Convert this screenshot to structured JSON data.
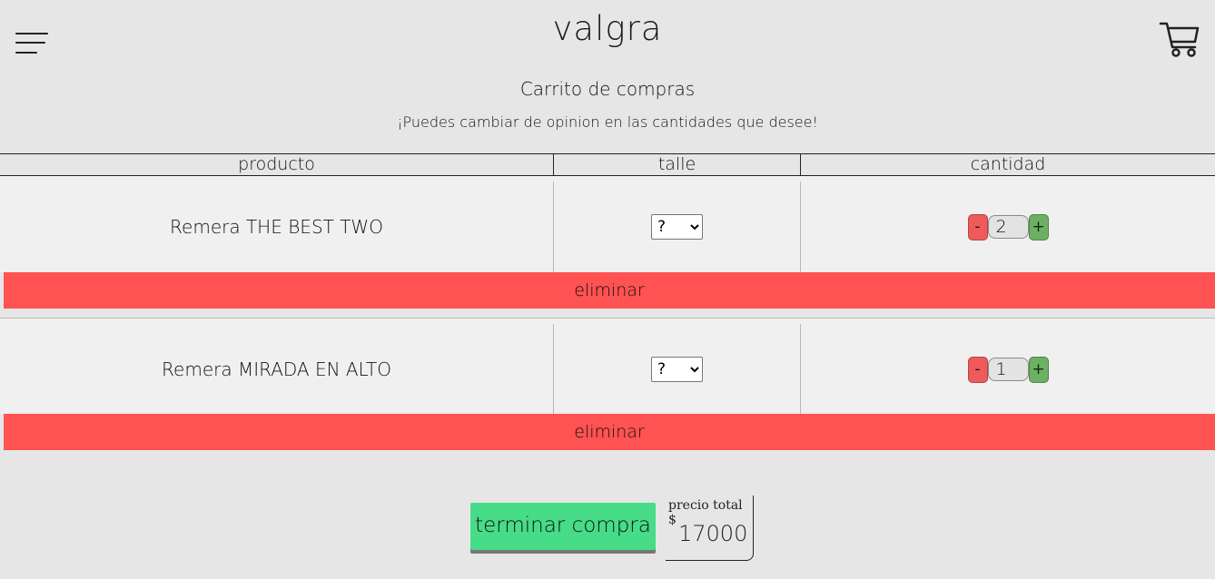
{
  "header": {
    "brand": "valgra",
    "menu_icon": "hamburger-menu-icon",
    "cart_icon": "shopping-cart-icon"
  },
  "page": {
    "title": "Carrito de compras",
    "subtitle": "¡Puedes cambiar de opinion en las cantidades que desee!"
  },
  "table": {
    "headers": [
      "producto",
      "talle",
      "cantidad"
    ]
  },
  "items": [
    {
      "name": "Remera THE BEST TWO",
      "size": "?",
      "quantity": "2",
      "minus": "-",
      "plus": "+",
      "delete_label": "eliminar"
    },
    {
      "name": "Remera MIRADA EN ALTO",
      "size": "?",
      "quantity": "1",
      "minus": "-",
      "plus": "+",
      "delete_label": "eliminar"
    }
  ],
  "footer": {
    "finish_label": "terminar compra",
    "total_label": "precio total $",
    "total_value": "17000"
  },
  "colors": {
    "background": "#e6e6e6",
    "row": "#f1f0f0",
    "delete": "#ff5252",
    "minus": "#ef5a5a",
    "plus": "#6cb063",
    "finish": "#47dc88"
  }
}
